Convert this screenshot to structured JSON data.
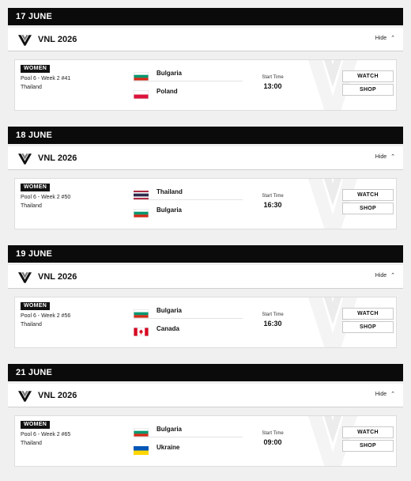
{
  "days": [
    {
      "date": "17 JUNE",
      "competition": "VNL 2026",
      "hide_label": "Hide",
      "match": {
        "gender": "WOMEN",
        "pool": "Pool 6 - Week 2 #41",
        "venue": "Thailand",
        "home": {
          "name": "Bulgaria",
          "flag": "bulgaria-flag"
        },
        "away": {
          "name": "Poland",
          "flag": "poland-flag"
        },
        "start_label": "Start Time",
        "start_time": "13:00",
        "watch_label": "WATCH",
        "shop_label": "SHOP"
      }
    },
    {
      "date": "18 JUNE",
      "competition": "VNL 2026",
      "hide_label": "Hide",
      "match": {
        "gender": "WOMEN",
        "pool": "Pool 6 - Week 2 #50",
        "venue": "Thailand",
        "home": {
          "name": "Thailand",
          "flag": "thailand-flag"
        },
        "away": {
          "name": "Bulgaria",
          "flag": "bulgaria-flag"
        },
        "start_label": "Start Time",
        "start_time": "16:30",
        "watch_label": "WATCH",
        "shop_label": "SHOP"
      }
    },
    {
      "date": "19 JUNE",
      "competition": "VNL 2026",
      "hide_label": "Hide",
      "match": {
        "gender": "WOMEN",
        "pool": "Pool 6 - Week 2 #56",
        "venue": "Thailand",
        "home": {
          "name": "Bulgaria",
          "flag": "bulgaria-flag"
        },
        "away": {
          "name": "Canada",
          "flag": "canada-flag"
        },
        "start_label": "Start Time",
        "start_time": "16:30",
        "watch_label": "WATCH",
        "shop_label": "SHOP"
      }
    },
    {
      "date": "21 JUNE",
      "competition": "VNL 2026",
      "hide_label": "Hide",
      "match": {
        "gender": "WOMEN",
        "pool": "Pool 6 - Week 2 #65",
        "venue": "Thailand",
        "home": {
          "name": "Bulgaria",
          "flag": "bulgaria-flag"
        },
        "away": {
          "name": "Ukraine",
          "flag": "ukraine-flag"
        },
        "start_label": "Start Time",
        "start_time": "09:00",
        "watch_label": "WATCH",
        "shop_label": "SHOP"
      }
    }
  ],
  "colors": {
    "header_bg": "#0b0b0b",
    "page_bg": "#f0f0f0",
    "card_bg": "#ffffff"
  },
  "icons": {
    "competition_logo": "vnl-logo-icon",
    "hide_toggle": "chevron-up-icon"
  }
}
